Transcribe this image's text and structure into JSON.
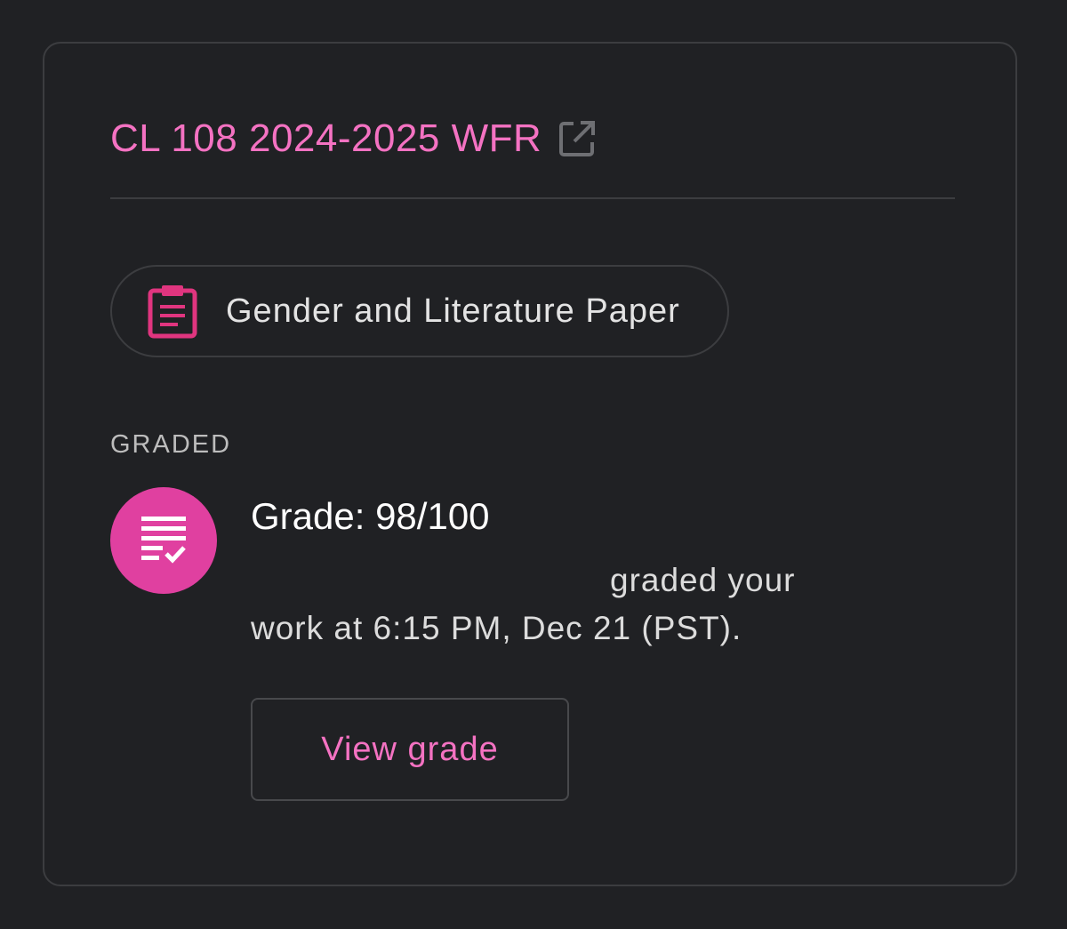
{
  "card": {
    "course_title": "CL 108 2024-2025 WFR",
    "course_link_icon": "open-in-new-icon",
    "assignment": {
      "icon": "clipboard-icon",
      "title": "Gender and Literature Paper"
    },
    "status_label": "GRADED",
    "grade_event": {
      "icon": "graded-document-icon",
      "grade_text": "Grade: 98/100",
      "description_line1": "graded your",
      "description_line2": "work at 6:15 PM, Dec 21 (PST)."
    },
    "view_grade_label": "View grade"
  },
  "colors": {
    "background": "#202124",
    "accent_pink": "#f472c2",
    "icon_pink": "#e040a0",
    "border": "#3c3d40"
  }
}
